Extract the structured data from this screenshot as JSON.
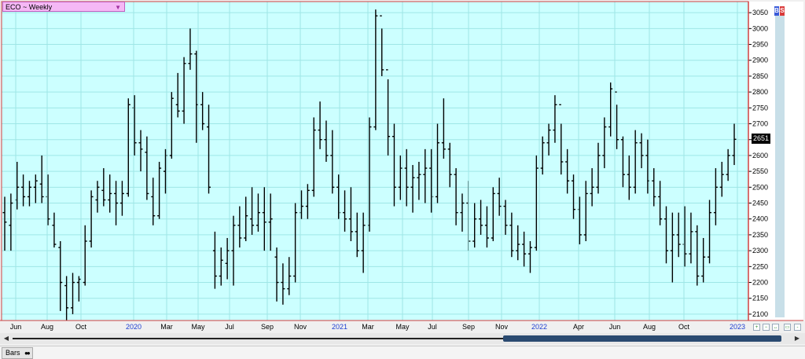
{
  "header": {
    "title": "ECO ~ Weekly",
    "dropdown_icon": "triangle-down-icon",
    "buy_label": "B",
    "sell_label": "S"
  },
  "last_price": "2651",
  "status_bar": {
    "tab_label": "Bars"
  },
  "colors": {
    "plot_bg": "#ccffff",
    "grid": "#9ee6e6",
    "border": "#d04040",
    "bars": "#000000",
    "year_label": "#1f3fd0",
    "axis_text": "#000000"
  },
  "chart_data": {
    "type": "ohlc",
    "title": "ECO ~ Weekly",
    "xlabel": "",
    "ylabel": "",
    "ylim": [
      2080,
      3085
    ],
    "grid": true,
    "y_ticks": [
      2100,
      2150,
      2200,
      2250,
      2300,
      2350,
      2400,
      2450,
      2500,
      2550,
      2600,
      2650,
      2700,
      2750,
      2800,
      2850,
      2900,
      2950,
      3000,
      3050
    ],
    "x_ticks": [
      {
        "label": "Jun",
        "year": false
      },
      {
        "label": "Aug",
        "year": false
      },
      {
        "label": "Oct",
        "year": false
      },
      {
        "label": "2020",
        "year": true
      },
      {
        "label": "Mar",
        "year": false
      },
      {
        "label": "May",
        "year": false
      },
      {
        "label": "Jul",
        "year": false
      },
      {
        "label": "Sep",
        "year": false
      },
      {
        "label": "Nov",
        "year": false
      },
      {
        "label": "2021",
        "year": true
      },
      {
        "label": "Mar",
        "year": false
      },
      {
        "label": "May",
        "year": false
      },
      {
        "label": "Jul",
        "year": false
      },
      {
        "label": "Sep",
        "year": false
      },
      {
        "label": "Nov",
        "year": false
      },
      {
        "label": "2022",
        "year": true
      },
      {
        "label": "Apr",
        "year": false
      },
      {
        "label": "Jun",
        "year": false
      },
      {
        "label": "Aug",
        "year": false
      },
      {
        "label": "Oct",
        "year": false
      },
      {
        "label": "2023",
        "year": true
      }
    ],
    "bars": [
      [
        2420,
        2470,
        2300,
        2390
      ],
      [
        2380,
        2480,
        2300,
        2450
      ],
      [
        2460,
        2580,
        2430,
        2500
      ],
      [
        2500,
        2540,
        2440,
        2470
      ],
      [
        2470,
        2520,
        2440,
        2500
      ],
      [
        2500,
        2540,
        2450,
        2520
      ],
      [
        2510,
        2600,
        2450,
        2470
      ],
      [
        2470,
        2540,
        2380,
        2400
      ],
      [
        2380,
        2420,
        2310,
        2320
      ],
      [
        2310,
        2330,
        2110,
        2200
      ],
      [
        2190,
        2220,
        2080,
        2120
      ],
      [
        2120,
        2230,
        2100,
        2200
      ],
      [
        2200,
        2220,
        2140,
        2210
      ],
      [
        2200,
        2380,
        2190,
        2330
      ],
      [
        2330,
        2490,
        2310,
        2470
      ],
      [
        2460,
        2520,
        2420,
        2500
      ],
      [
        2490,
        2560,
        2440,
        2460
      ],
      [
        2460,
        2540,
        2420,
        2480
      ],
      [
        2480,
        2520,
        2380,
        2450
      ],
      [
        2450,
        2520,
        2410,
        2480
      ],
      [
        2480,
        2780,
        2470,
        2760
      ],
      [
        2750,
        2790,
        2600,
        2640
      ],
      [
        2640,
        2680,
        2550,
        2620
      ],
      [
        2610,
        2660,
        2460,
        2480
      ],
      [
        2470,
        2530,
        2380,
        2410
      ],
      [
        2410,
        2580,
        2400,
        2560
      ],
      [
        2550,
        2620,
        2480,
        2600
      ],
      [
        2600,
        2800,
        2590,
        2780
      ],
      [
        2760,
        2860,
        2720,
        2740
      ],
      [
        2740,
        2910,
        2700,
        2890
      ],
      [
        2890,
        3000,
        2870,
        2920
      ],
      [
        2920,
        2930,
        2640,
        2760
      ],
      [
        2760,
        2800,
        2680,
        2700
      ],
      [
        2690,
        2760,
        2480,
        2500
      ],
      [
        2300,
        2360,
        2180,
        2220
      ],
      [
        2220,
        2310,
        2190,
        2270
      ],
      [
        2260,
        2340,
        2210,
        2300
      ],
      [
        2300,
        2410,
        2190,
        2380
      ],
      [
        2380,
        2440,
        2310,
        2340
      ],
      [
        2340,
        2470,
        2330,
        2410
      ],
      [
        2400,
        2500,
        2350,
        2380
      ],
      [
        2380,
        2480,
        2360,
        2420
      ],
      [
        2420,
        2500,
        2300,
        2390
      ],
      [
        2390,
        2480,
        2300,
        2400
      ],
      [
        2280,
        2310,
        2140,
        2200
      ],
      [
        2200,
        2260,
        2130,
        2180
      ],
      [
        2180,
        2280,
        2160,
        2220
      ],
      [
        2220,
        2450,
        2200,
        2420
      ],
      [
        2420,
        2490,
        2400,
        2440
      ],
      [
        2440,
        2510,
        2400,
        2490
      ],
      [
        2490,
        2720,
        2470,
        2680
      ],
      [
        2680,
        2770,
        2620,
        2650
      ],
      [
        2650,
        2710,
        2580,
        2600
      ],
      [
        2600,
        2680,
        2480,
        2500
      ],
      [
        2500,
        2540,
        2400,
        2420
      ],
      [
        2420,
        2490,
        2360,
        2400
      ],
      [
        2400,
        2500,
        2330,
        2360
      ],
      [
        2360,
        2420,
        2280,
        2300
      ],
      [
        2300,
        2420,
        2230,
        2380
      ],
      [
        2380,
        2720,
        2360,
        2690
      ],
      [
        2690,
        3060,
        2680,
        3040
      ],
      [
        3040,
        3000,
        2850,
        2870
      ],
      [
        2870,
        2840,
        2600,
        2660
      ],
      [
        2660,
        2700,
        2440,
        2500
      ],
      [
        2500,
        2600,
        2460,
        2560
      ],
      [
        2560,
        2620,
        2440,
        2500
      ],
      [
        2500,
        2570,
        2420,
        2530
      ],
      [
        2530,
        2580,
        2460,
        2540
      ],
      [
        2540,
        2620,
        2450,
        2560
      ],
      [
        2560,
        2620,
        2420,
        2470
      ],
      [
        2470,
        2700,
        2450,
        2640
      ],
      [
        2640,
        2780,
        2590,
        2620
      ],
      [
        2620,
        2640,
        2500,
        2540
      ],
      [
        2540,
        2560,
        2380,
        2420
      ],
      [
        2420,
        2480,
        2360,
        2450
      ],
      [
        2450,
        2520,
        2300,
        2330
      ],
      [
        2330,
        2450,
        2310,
        2400
      ],
      [
        2400,
        2460,
        2350,
        2380
      ],
      [
        2380,
        2440,
        2310,
        2340
      ],
      [
        2340,
        2500,
        2330,
        2480
      ],
      [
        2480,
        2530,
        2410,
        2440
      ],
      [
        2440,
        2460,
        2350,
        2380
      ],
      [
        2380,
        2420,
        2280,
        2300
      ],
      [
        2300,
        2380,
        2270,
        2320
      ],
      [
        2320,
        2360,
        2250,
        2290
      ],
      [
        2290,
        2330,
        2230,
        2310
      ],
      [
        2310,
        2600,
        2300,
        2560
      ],
      [
        2560,
        2660,
        2540,
        2640
      ],
      [
        2640,
        2700,
        2600,
        2680
      ],
      [
        2680,
        2790,
        2640,
        2760
      ],
      [
        2760,
        2700,
        2540,
        2580
      ],
      [
        2580,
        2620,
        2480,
        2520
      ],
      [
        2520,
        2540,
        2400,
        2430
      ],
      [
        2430,
        2470,
        2320,
        2350
      ],
      [
        2350,
        2520,
        2330,
        2480
      ],
      [
        2480,
        2560,
        2440,
        2500
      ],
      [
        2500,
        2640,
        2480,
        2600
      ],
      [
        2600,
        2720,
        2560,
        2690
      ],
      [
        2690,
        2830,
        2660,
        2810
      ],
      [
        2800,
        2760,
        2620,
        2650
      ],
      [
        2650,
        2660,
        2500,
        2540
      ],
      [
        2540,
        2600,
        2460,
        2500
      ],
      [
        2500,
        2680,
        2480,
        2640
      ],
      [
        2640,
        2670,
        2560,
        2600
      ],
      [
        2600,
        2650,
        2480,
        2520
      ],
      [
        2520,
        2560,
        2440,
        2470
      ],
      [
        2470,
        2520,
        2380,
        2400
      ],
      [
        2400,
        2440,
        2260,
        2300
      ],
      [
        2300,
        2420,
        2200,
        2350
      ],
      [
        2350,
        2420,
        2280,
        2320
      ],
      [
        2320,
        2440,
        2250,
        2290
      ],
      [
        2290,
        2420,
        2260,
        2360
      ],
      [
        2360,
        2380,
        2190,
        2220
      ],
      [
        2220,
        2340,
        2200,
        2280
      ],
      [
        2280,
        2460,
        2260,
        2420
      ],
      [
        2420,
        2560,
        2380,
        2500
      ],
      [
        2500,
        2580,
        2470,
        2540
      ],
      [
        2540,
        2620,
        2520,
        2600
      ],
      [
        2600,
        2700,
        2570,
        2651
      ]
    ]
  }
}
